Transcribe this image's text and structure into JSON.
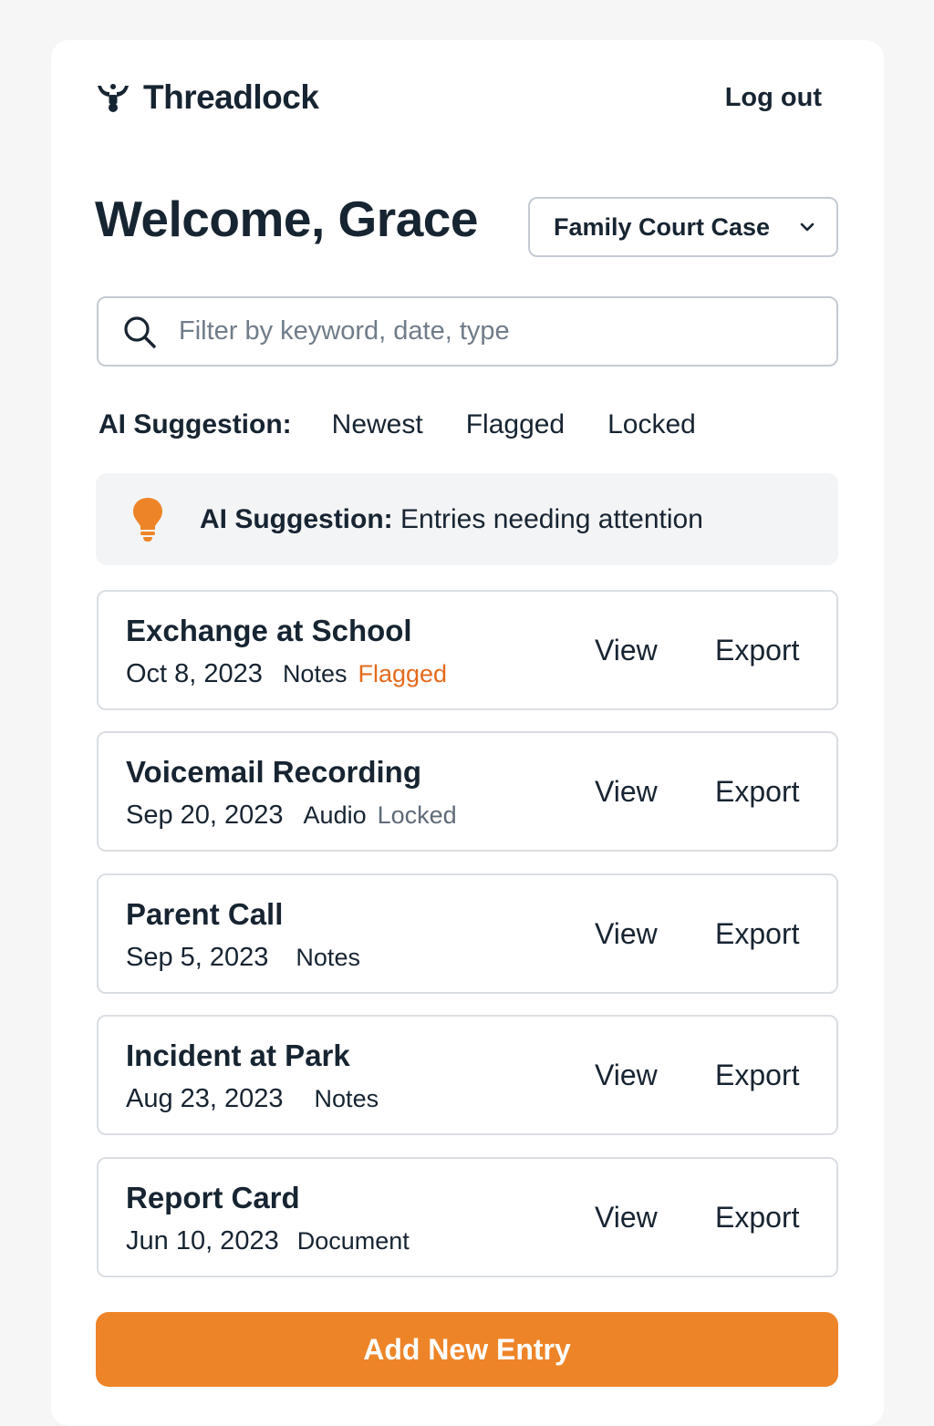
{
  "brand": {
    "name": "Threadlock",
    "logo_icon": "threadlock-logo-icon"
  },
  "header": {
    "logout_label": "Log out"
  },
  "welcome": {
    "title": "Welcome, Grace"
  },
  "case_selector": {
    "selected": "Family Court Case",
    "icon": "chevron-down-icon"
  },
  "search": {
    "placeholder": "Filter by keyword, date, type",
    "value": "",
    "icon": "search-icon"
  },
  "filters": {
    "label": "AI Suggestion:",
    "chips": [
      "Newest",
      "Flagged",
      "Locked"
    ]
  },
  "banner": {
    "icon": "lightbulb-icon",
    "label": "AI Suggestion:",
    "text": "Entries needing attention"
  },
  "entries": [
    {
      "title": "Exchange at School",
      "date": "Oct 8, 2023",
      "type": "Notes",
      "tag": "Flagged",
      "view_label": "View",
      "export_label": "Export"
    },
    {
      "title": "Voicemail Recording",
      "date": "Sep 20, 2023",
      "type": "Audio",
      "tag": "Locked",
      "view_label": "View",
      "export_label": "Export"
    },
    {
      "title": "Parent Call",
      "date": "Sep 5, 2023",
      "type": "Notes",
      "tag": "",
      "view_label": "View",
      "export_label": "Export"
    },
    {
      "title": "Incident at Park",
      "date": "Aug 23, 2023",
      "type": "Notes",
      "tag": "",
      "view_label": "View",
      "export_label": "Export"
    },
    {
      "title": "Report Card",
      "date": "Jun 10, 2023",
      "type": "Document",
      "tag": "",
      "view_label": "View",
      "export_label": "Export"
    }
  ],
  "actions": {
    "add_label": "Add New Entry"
  },
  "colors": {
    "accent": "#ee8428",
    "flagged": "#e46a1c",
    "locked": "#5f6b78",
    "text": "#172432",
    "border": "#c5cbd3"
  }
}
